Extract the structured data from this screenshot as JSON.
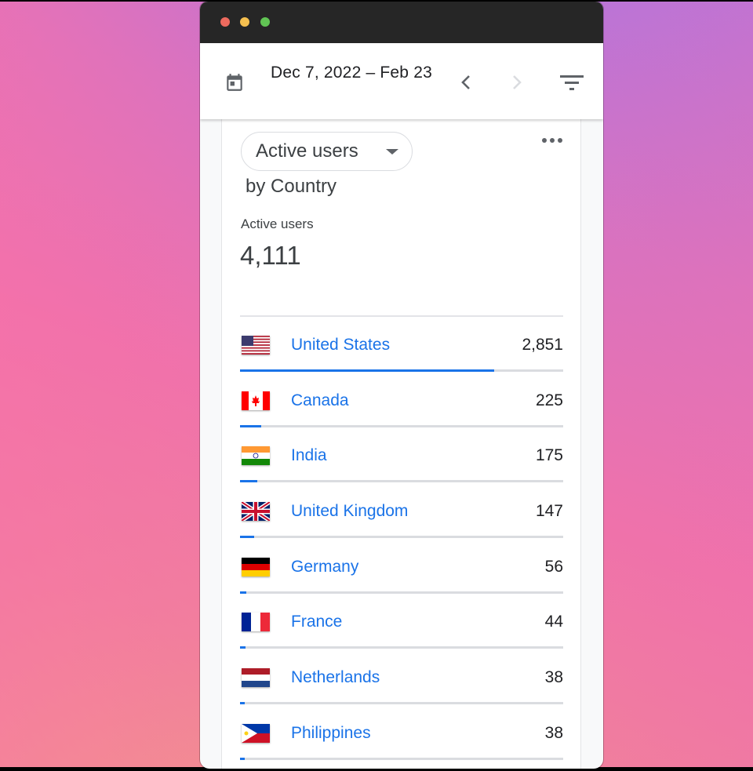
{
  "window": {
    "traffic_lights": [
      "close",
      "minimize",
      "zoom"
    ]
  },
  "header": {
    "calendar_icon": "calendar-icon",
    "date_range": "Dec 7, 2022 – Feb 23",
    "prev_icon": "chevron-left-icon",
    "next_icon": "chevron-right-icon",
    "next_enabled": false,
    "filter_icon": "filter-icon"
  },
  "card": {
    "metric_selector": "Active users",
    "subtitle": "by Country",
    "more_icon": "more-horizontal-icon",
    "kpi_label": "Active users",
    "kpi_value": "4,111",
    "rows": [
      {
        "country": "United States",
        "value": "2,851",
        "share": 0.786,
        "flag": "us"
      },
      {
        "country": "Canada",
        "value": "225",
        "share": 0.066,
        "flag": "ca"
      },
      {
        "country": "India",
        "value": "175",
        "share": 0.053,
        "flag": "in"
      },
      {
        "country": "United Kingdom",
        "value": "147",
        "share": 0.044,
        "flag": "gb"
      },
      {
        "country": "Germany",
        "value": "56",
        "share": 0.02,
        "flag": "de"
      },
      {
        "country": "France",
        "value": "44",
        "share": 0.016,
        "flag": "fr"
      },
      {
        "country": "Netherlands",
        "value": "38",
        "share": 0.014,
        "flag": "nl"
      },
      {
        "country": "Philippines",
        "value": "38",
        "share": 0.014,
        "flag": "ph"
      }
    ]
  },
  "colors": {
    "accent": "#1a73e8",
    "bar_track": "#dadce0",
    "text_primary": "#202124",
    "titlebar": "#262626"
  }
}
